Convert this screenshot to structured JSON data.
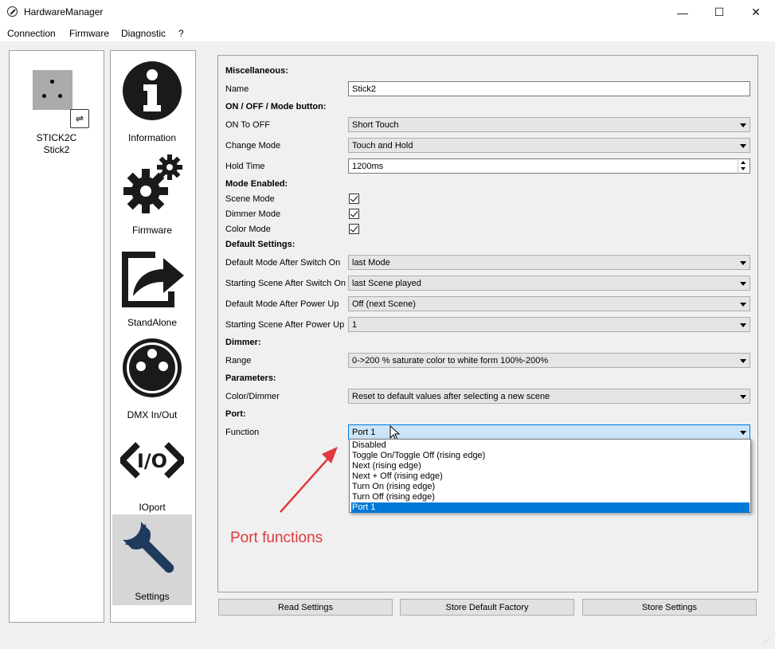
{
  "window": {
    "title": "HardwareManager",
    "controls": {
      "minimize": "—",
      "maximize": "☐",
      "close": "✕"
    }
  },
  "menu": [
    "Connection",
    "Firmware",
    "Diagnostic",
    "?"
  ],
  "device": {
    "model": "STICK2C",
    "name": "Stick2"
  },
  "nav": [
    {
      "label": "Information",
      "icon": "info-icon"
    },
    {
      "label": "Firmware",
      "icon": "gears-icon"
    },
    {
      "label": "StandAlone",
      "icon": "export-arrow-icon"
    },
    {
      "label": "DMX In/Out",
      "icon": "xlr-connector-icon"
    },
    {
      "label": "IOport",
      "icon": "io-code-icon"
    },
    {
      "label": "Settings",
      "icon": "wrench-icon",
      "selected": true
    }
  ],
  "sections": {
    "misc": "Miscellaneous:",
    "onoff": "ON / OFF / Mode button:",
    "modes": "Mode Enabled:",
    "defaults": "Default Settings:",
    "dimmer": "Dimmer:",
    "parameters": "Parameters:",
    "port": "Port:"
  },
  "fields": {
    "name": {
      "label": "Name",
      "value": "Stick2"
    },
    "on_to_off": {
      "label": "ON To OFF",
      "value": "Short Touch"
    },
    "change_mode": {
      "label": "Change Mode",
      "value": "Touch and Hold"
    },
    "hold_time": {
      "label": "Hold Time",
      "value": "1200ms"
    },
    "scene_mode": {
      "label": "Scene Mode",
      "checked": true
    },
    "dimmer_mode": {
      "label": "Dimmer Mode",
      "checked": true
    },
    "color_mode": {
      "label": "Color Mode",
      "checked": true
    },
    "default_mode_switch": {
      "label": "Default Mode After Switch On",
      "value": "last Mode"
    },
    "start_scene_switch": {
      "label": "Starting Scene After Switch On",
      "value": "last Scene played"
    },
    "default_mode_power": {
      "label": "Default Mode After Power Up",
      "value": "Off (next Scene)"
    },
    "start_scene_power": {
      "label": "Starting Scene After Power Up",
      "value": "1"
    },
    "range": {
      "label": "Range",
      "value": "0->200 % saturate color to white form 100%-200%"
    },
    "color_dimmer": {
      "label": "Color/Dimmer",
      "value": "Reset to default values after selecting a new scene"
    },
    "function": {
      "label": "Function",
      "value": "Port 1"
    }
  },
  "function_options": [
    "Disabled",
    "Toggle On/Toggle Off (rising edge)",
    "Next (rising edge)",
    "Next + Off (rising edge)",
    "Turn On (rising edge)",
    "Turn Off (rising edge)",
    "Port 1"
  ],
  "function_selected_index": 6,
  "buttons": {
    "read": "Read Settings",
    "store_factory": "Store Default Factory",
    "store": "Store Settings"
  },
  "annotation": "Port functions",
  "colors": {
    "accent": "#0078d7",
    "annotation": "#e0393d",
    "icon": "#1a1a1a",
    "wrench": "#1f3a5c"
  }
}
